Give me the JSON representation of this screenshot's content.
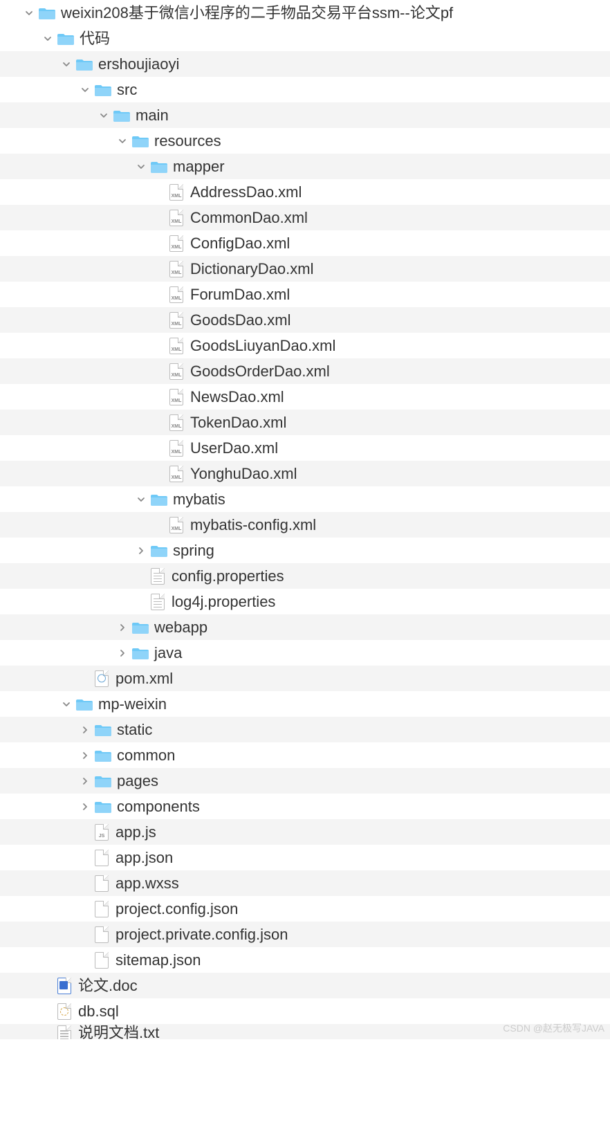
{
  "tree": [
    {
      "indent": 0,
      "chevron": "down",
      "icon": "folder",
      "label": "weixin208基于微信小程序的二手物品交易平台ssm--论文pf",
      "alt": false
    },
    {
      "indent": 1,
      "chevron": "down",
      "icon": "folder",
      "label": "代码",
      "alt": false
    },
    {
      "indent": 2,
      "chevron": "down",
      "icon": "folder",
      "label": "ershoujiaoyi",
      "alt": true
    },
    {
      "indent": 3,
      "chevron": "down",
      "icon": "folder",
      "label": "src",
      "alt": false
    },
    {
      "indent": 4,
      "chevron": "down",
      "icon": "folder",
      "label": "main",
      "alt": true
    },
    {
      "indent": 5,
      "chevron": "down",
      "icon": "folder",
      "label": "resources",
      "alt": false
    },
    {
      "indent": 6,
      "chevron": "down",
      "icon": "folder",
      "label": "mapper",
      "alt": true
    },
    {
      "indent": 7,
      "chevron": "none",
      "icon": "xml",
      "label": "AddressDao.xml",
      "alt": false
    },
    {
      "indent": 7,
      "chevron": "none",
      "icon": "xml",
      "label": "CommonDao.xml",
      "alt": true
    },
    {
      "indent": 7,
      "chevron": "none",
      "icon": "xml",
      "label": "ConfigDao.xml",
      "alt": false
    },
    {
      "indent": 7,
      "chevron": "none",
      "icon": "xml",
      "label": "DictionaryDao.xml",
      "alt": true
    },
    {
      "indent": 7,
      "chevron": "none",
      "icon": "xml",
      "label": "ForumDao.xml",
      "alt": false
    },
    {
      "indent": 7,
      "chevron": "none",
      "icon": "xml",
      "label": "GoodsDao.xml",
      "alt": true
    },
    {
      "indent": 7,
      "chevron": "none",
      "icon": "xml",
      "label": "GoodsLiuyanDao.xml",
      "alt": false
    },
    {
      "indent": 7,
      "chevron": "none",
      "icon": "xml",
      "label": "GoodsOrderDao.xml",
      "alt": true
    },
    {
      "indent": 7,
      "chevron": "none",
      "icon": "xml",
      "label": "NewsDao.xml",
      "alt": false
    },
    {
      "indent": 7,
      "chevron": "none",
      "icon": "xml",
      "label": "TokenDao.xml",
      "alt": true
    },
    {
      "indent": 7,
      "chevron": "none",
      "icon": "xml",
      "label": "UserDao.xml",
      "alt": false
    },
    {
      "indent": 7,
      "chevron": "none",
      "icon": "xml",
      "label": "YonghuDao.xml",
      "alt": true
    },
    {
      "indent": 6,
      "chevron": "down",
      "icon": "folder",
      "label": "mybatis",
      "alt": false
    },
    {
      "indent": 7,
      "chevron": "none",
      "icon": "xml",
      "label": "mybatis-config.xml",
      "alt": true
    },
    {
      "indent": 6,
      "chevron": "right",
      "icon": "folder",
      "label": "spring",
      "alt": false
    },
    {
      "indent": 6,
      "chevron": "none",
      "icon": "txtfile",
      "label": "config.properties",
      "alt": true
    },
    {
      "indent": 6,
      "chevron": "none",
      "icon": "txtfile",
      "label": "log4j.properties",
      "alt": false
    },
    {
      "indent": 5,
      "chevron": "right",
      "icon": "folder",
      "label": "webapp",
      "alt": true
    },
    {
      "indent": 5,
      "chevron": "right",
      "icon": "folder",
      "label": "java",
      "alt": false
    },
    {
      "indent": 3,
      "chevron": "none",
      "icon": "pom",
      "label": "pom.xml",
      "alt": true
    },
    {
      "indent": 2,
      "chevron": "down",
      "icon": "folder",
      "label": "mp-weixin",
      "alt": false
    },
    {
      "indent": 3,
      "chevron": "right",
      "icon": "folder",
      "label": "static",
      "alt": true
    },
    {
      "indent": 3,
      "chevron": "right",
      "icon": "folder",
      "label": "common",
      "alt": false
    },
    {
      "indent": 3,
      "chevron": "right",
      "icon": "folder",
      "label": "pages",
      "alt": true
    },
    {
      "indent": 3,
      "chevron": "right",
      "icon": "folder",
      "label": "components",
      "alt": false
    },
    {
      "indent": 3,
      "chevron": "none",
      "icon": "js",
      "label": "app.js",
      "alt": true
    },
    {
      "indent": 3,
      "chevron": "none",
      "icon": "file",
      "label": "app.json",
      "alt": false
    },
    {
      "indent": 3,
      "chevron": "none",
      "icon": "file",
      "label": "app.wxss",
      "alt": true
    },
    {
      "indent": 3,
      "chevron": "none",
      "icon": "file",
      "label": "project.config.json",
      "alt": false
    },
    {
      "indent": 3,
      "chevron": "none",
      "icon": "file",
      "label": "project.private.config.json",
      "alt": true
    },
    {
      "indent": 3,
      "chevron": "none",
      "icon": "file",
      "label": "sitemap.json",
      "alt": false
    },
    {
      "indent": 1,
      "chevron": "none",
      "icon": "doc",
      "label": "论文.doc",
      "alt": true
    },
    {
      "indent": 1,
      "chevron": "none",
      "icon": "sql",
      "label": "db.sql",
      "alt": false
    },
    {
      "indent": 1,
      "chevron": "none",
      "icon": "txtfile",
      "label": "说明文档.txt",
      "alt": true,
      "cut": true
    }
  ],
  "indentUnit": 27,
  "baseIndent": 34,
  "watermark": "CSDN @赵无极写JAVA"
}
